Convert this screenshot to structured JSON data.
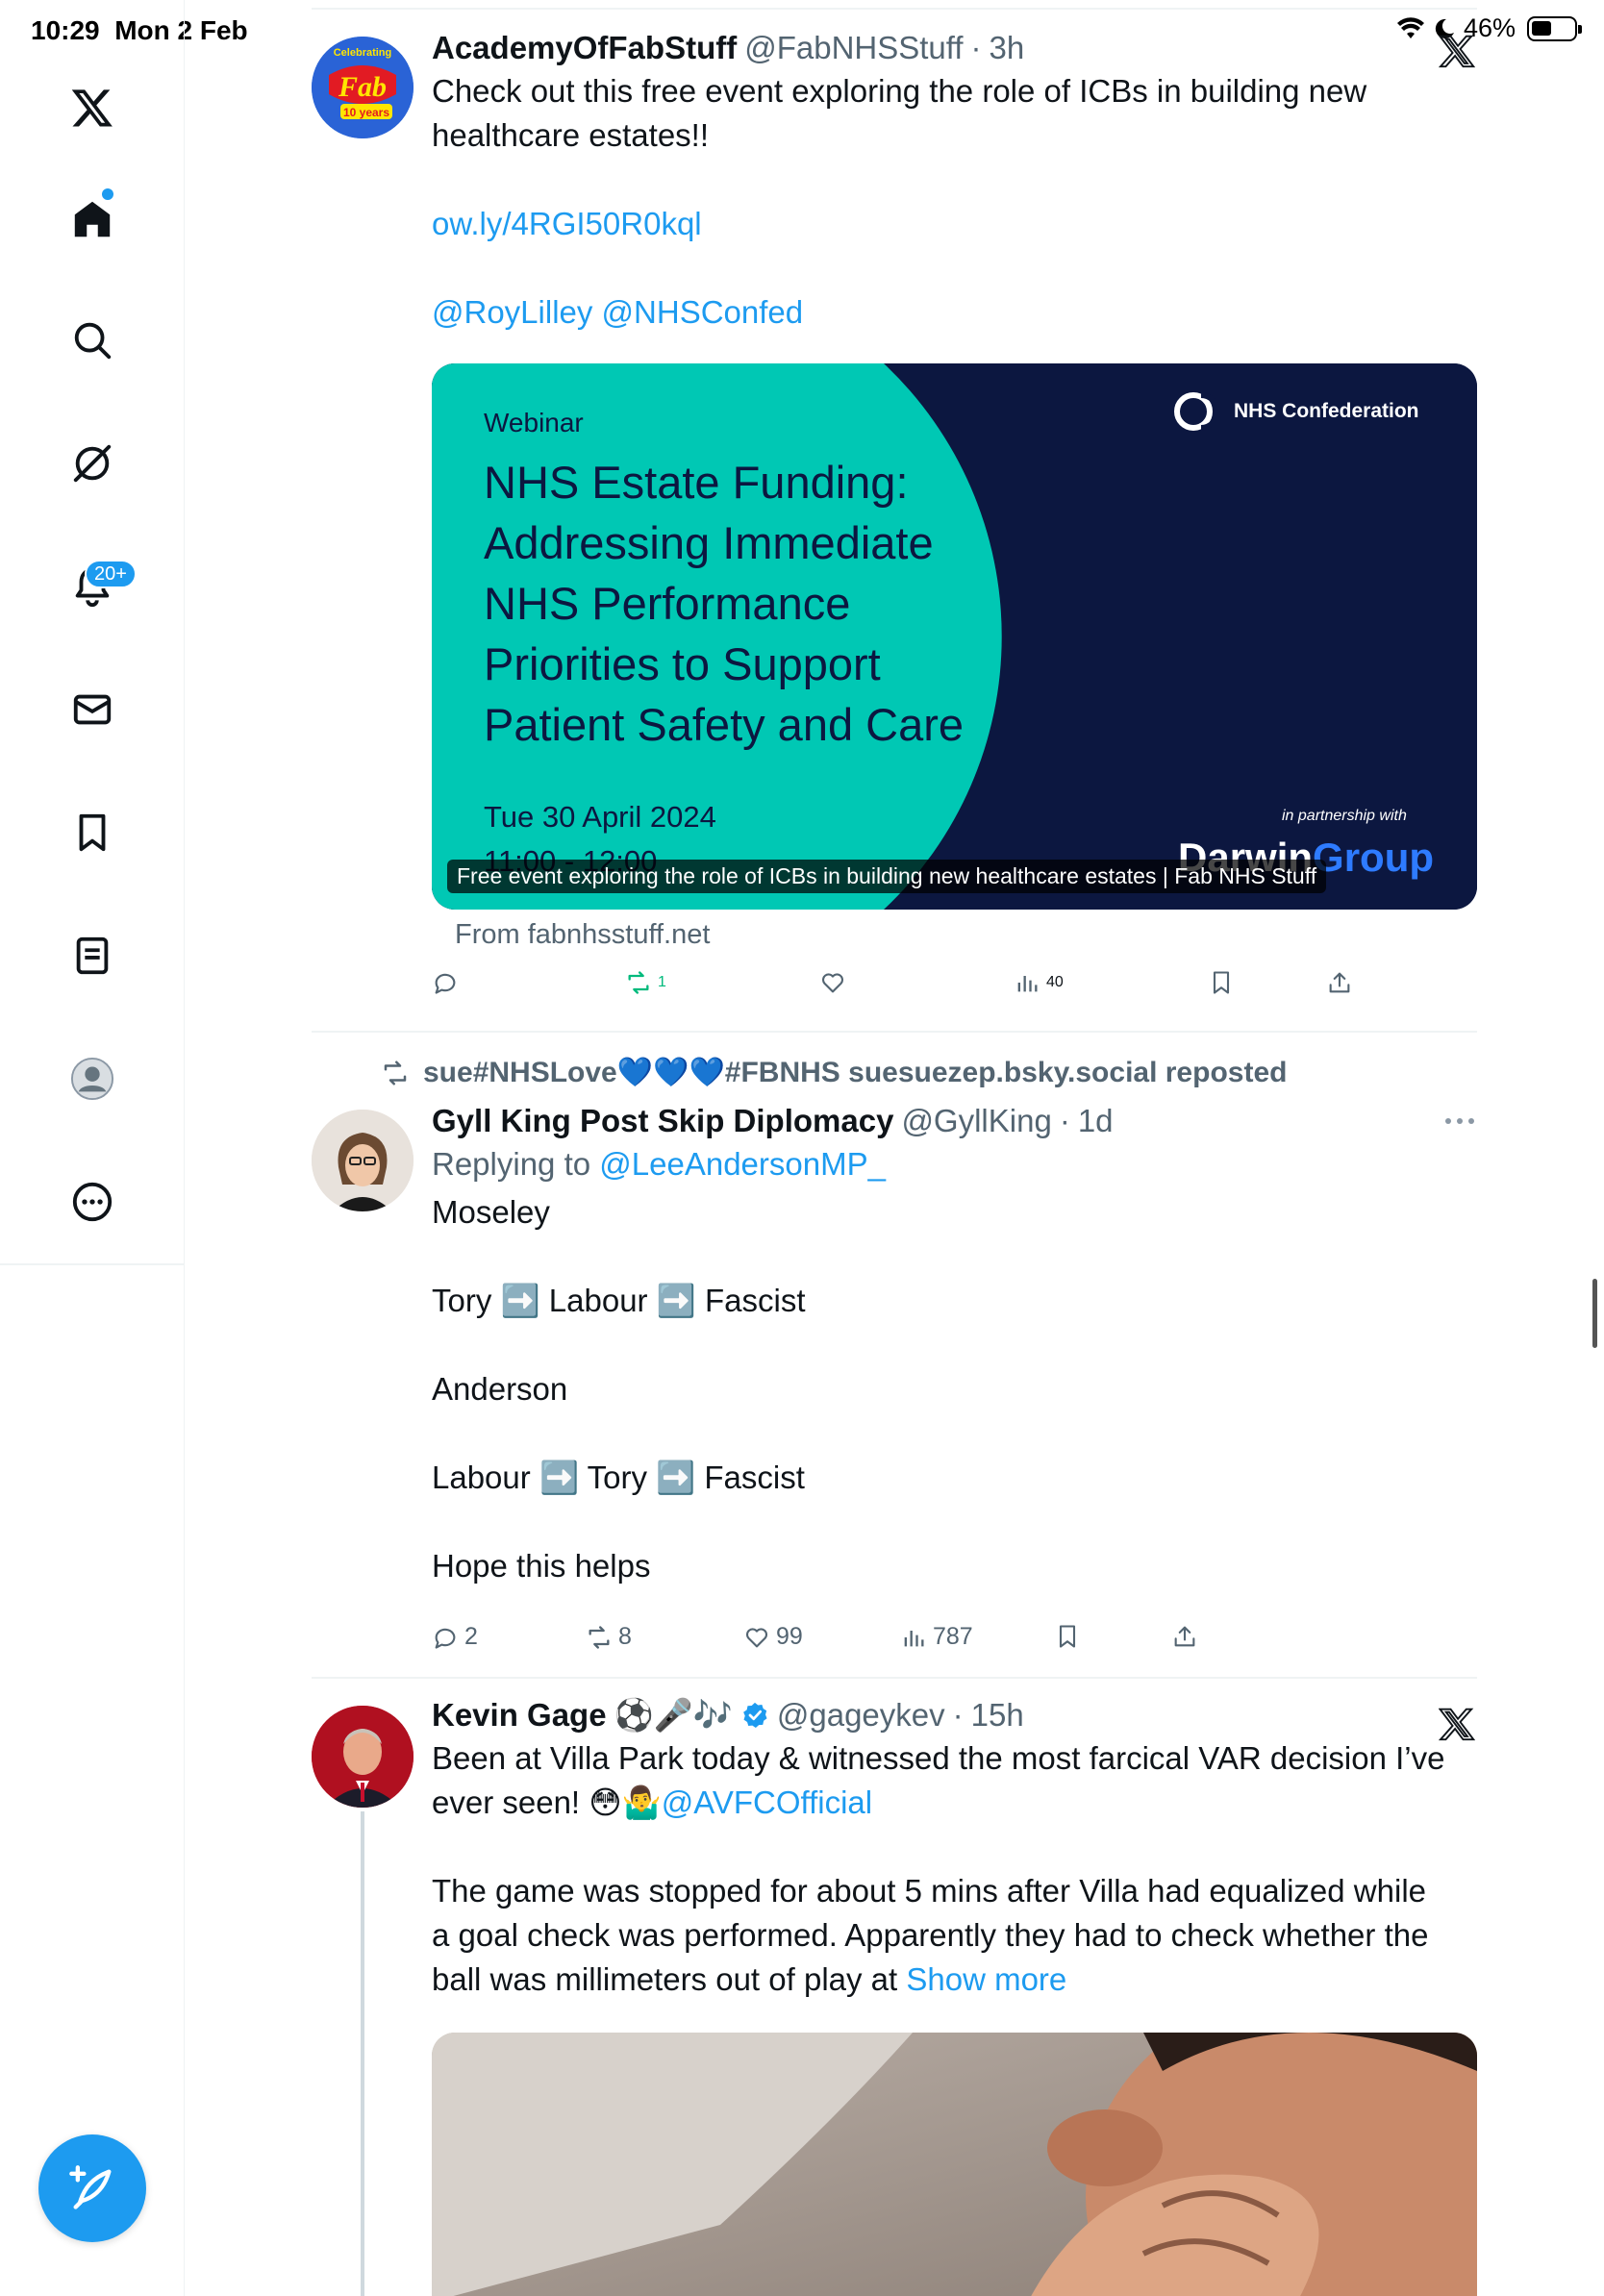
{
  "status": {
    "time": "10:29",
    "date": "Mon 2 Feb",
    "battery": "46%"
  },
  "sidebar": {
    "notification_badge": "20+",
    "items": [
      {
        "name": "x-logo"
      },
      {
        "name": "home"
      },
      {
        "name": "search"
      },
      {
        "name": "grok"
      },
      {
        "name": "notifications"
      },
      {
        "name": "messages"
      },
      {
        "name": "bookmarks"
      },
      {
        "name": "lists"
      },
      {
        "name": "profile"
      },
      {
        "name": "more"
      }
    ]
  },
  "tweets": [
    {
      "name": "AcademyOfFabStuff",
      "handle": "@FabNHSStuff",
      "time": "3h",
      "avatar_text": {
        "top": "Celebrating",
        "middle": "Fab",
        "bottom": "10 years"
      },
      "lines": {
        "l1": "Check out this free event exploring the role of ICBs in building new",
        "l2": "healthcare estates!!",
        "link": "ow.ly/4RGI50R0kql",
        "mentions": "@RoyLilley @NHSConfed"
      },
      "card": {
        "label": "Webinar",
        "title_lines": [
          "NHS Estate Funding:",
          "Addressing Immediate",
          "NHS Performance",
          "Priorities to Support",
          "Patient Safety and Care"
        ],
        "date": "Tue 30 April 2024",
        "time": "11:00 - 12:00",
        "org": "NHS Confederation",
        "partner_label": "in partnership with",
        "partner_a": "Darwin",
        "partner_b": "Group",
        "caption": "Free event exploring the role of ICBs in building new healthcare estates | Fab NHS Stuff",
        "from": "From fabnhsstuff.net"
      },
      "stats": {
        "replies": "",
        "reposts": "1",
        "likes": "",
        "views": "40"
      }
    },
    {
      "repost_line": "sue#NHSLove💙💙💙#FBNHS suesuezep.bsky.social reposted",
      "name": "Gyll King Post Skip Diplomacy",
      "handle": "@GyllKing",
      "time": "1d",
      "replying_label": "Replying to",
      "replying_to": "@LeeAndersonMP_",
      "lines": {
        "l1": "Moseley",
        "l2a": "Tory",
        "l2b": "Labour",
        "l2c": "Fascist",
        "l3": "Anderson",
        "l4a": "Labour",
        "l4b": "Tory",
        "l4c": "Fascist",
        "l5": "Hope this helps"
      },
      "stats": {
        "replies": "2",
        "reposts": "8",
        "likes": "99",
        "views": "787"
      }
    },
    {
      "name": "Kevin Gage",
      "name_emoji": "⚽🎤🎶",
      "handle": "@gageykev",
      "time": "15h",
      "lines": {
        "l1": "Been at Villa Park today & witnessed the most farcical VAR decision I’ve",
        "l2a": "ever seen! 😳🤷‍♂️",
        "l2b": "@AVFCOfficial",
        "l3": "The game was stopped for about 5 mins after Villa had equalized while",
        "l4": "a goal check was performed.  Apparently they had to check whether the",
        "l5a": "ball was millimeters out of play at",
        "l5b": "Show more"
      }
    }
  ],
  "colors": {
    "accent": "#1d9bf0",
    "repost": "#00ba7c",
    "muted": "#536471",
    "card_teal": "#00c8b4",
    "card_navy": "#0c1740"
  }
}
